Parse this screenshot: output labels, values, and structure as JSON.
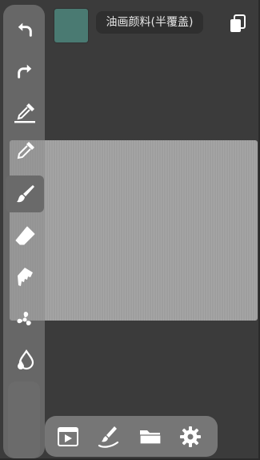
{
  "top_bar": {
    "brush_name": "油画颜料(半覆盖)",
    "current_color": "#4a7a72"
  },
  "tools": [
    {
      "name": "undo",
      "icon": "undo-icon"
    },
    {
      "name": "redo",
      "icon": "redo-icon"
    },
    {
      "name": "eyedropper-line",
      "icon": "eyedropper-line-icon"
    },
    {
      "name": "eyedropper",
      "icon": "eyedropper-icon"
    },
    {
      "name": "brush",
      "icon": "brush-icon",
      "active": true
    },
    {
      "name": "eraser",
      "icon": "eraser-icon"
    },
    {
      "name": "smudge",
      "icon": "smudge-icon"
    },
    {
      "name": "blur",
      "icon": "fan-icon"
    },
    {
      "name": "water",
      "icon": "water-drops-icon"
    }
  ],
  "dock": [
    {
      "name": "gallery",
      "icon": "film-icon"
    },
    {
      "name": "brush-settings",
      "icon": "brush-stroke-icon"
    },
    {
      "name": "open-folder",
      "icon": "folder-icon"
    },
    {
      "name": "settings",
      "icon": "gear-icon"
    }
  ],
  "colors": {
    "background": "#3b3b3b",
    "canvas": "#a3a3a3",
    "rail": "#8c8c8c",
    "dock": "#767676",
    "icon": "#ffffff"
  }
}
